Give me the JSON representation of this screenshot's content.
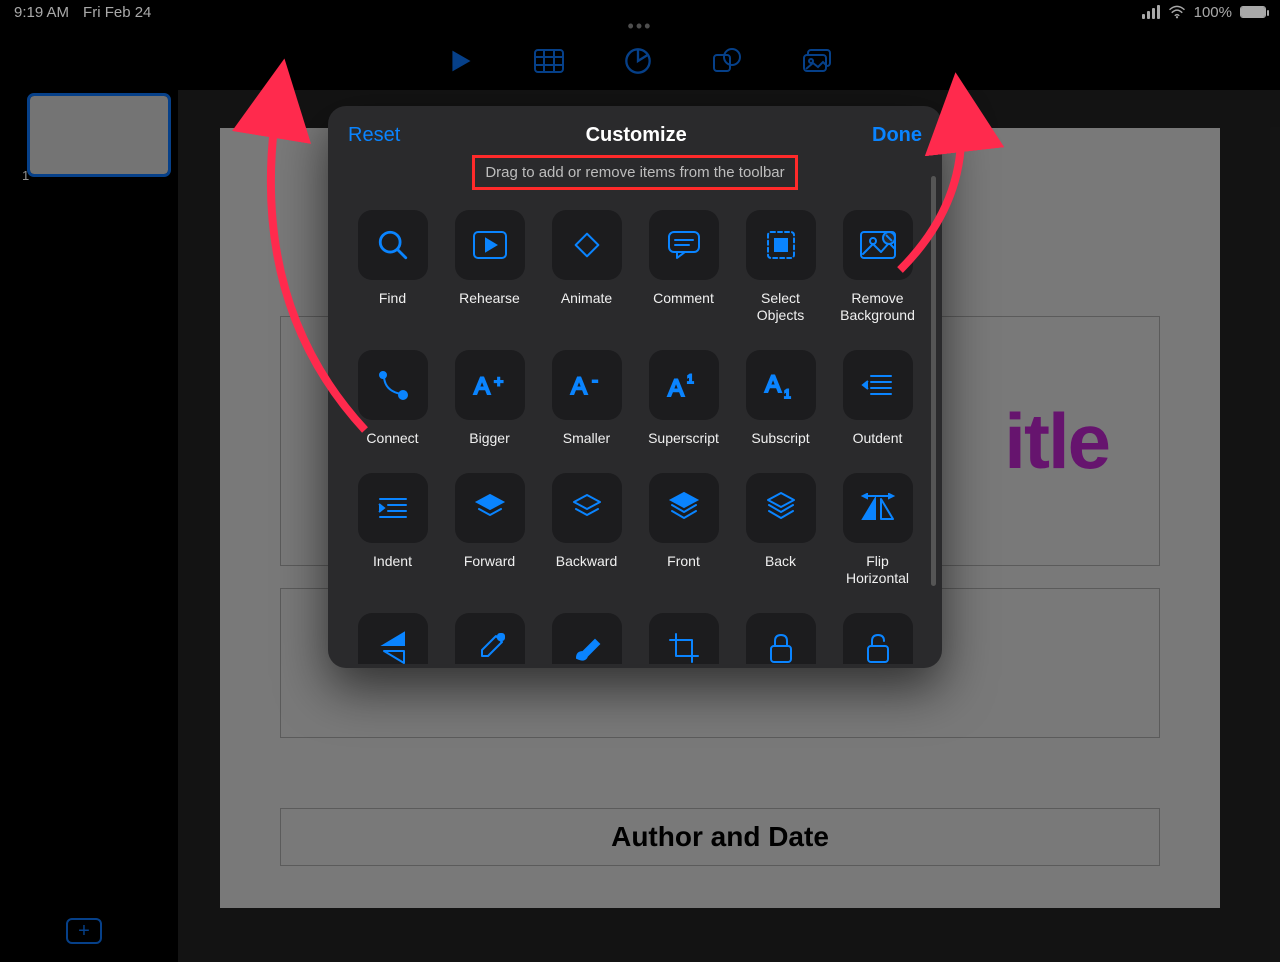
{
  "status": {
    "time": "9:19 AM",
    "date": "Fri Feb 24",
    "battery_pct": "100%"
  },
  "toolbar_icons": [
    "play-icon",
    "table-icon",
    "chart-icon",
    "shape-icon",
    "media-icon"
  ],
  "slide_panel": {
    "thumb_number": "1"
  },
  "slide_content": {
    "title_fragment": "itle",
    "author_placeholder": "Author and Date"
  },
  "popover": {
    "reset": "Reset",
    "title": "Customize",
    "done": "Done",
    "subtitle": "Drag to add or remove items from the toolbar",
    "tools": [
      {
        "key": "find",
        "label": "Find",
        "icon": "magnify"
      },
      {
        "key": "rehearse",
        "label": "Rehearse",
        "icon": "play-rect"
      },
      {
        "key": "animate",
        "label": "Animate",
        "icon": "diamond"
      },
      {
        "key": "comment",
        "label": "Comment",
        "icon": "comment"
      },
      {
        "key": "select-objects",
        "label": "Select Objects",
        "icon": "select-all"
      },
      {
        "key": "remove-background",
        "label": "Remove Background",
        "icon": "remove-bg"
      },
      {
        "key": "connect",
        "label": "Connect",
        "icon": "connect"
      },
      {
        "key": "bigger",
        "label": "Bigger",
        "icon": "a-plus"
      },
      {
        "key": "smaller",
        "label": "Smaller",
        "icon": "a-minus"
      },
      {
        "key": "superscript",
        "label": "Superscript",
        "icon": "a-sup"
      },
      {
        "key": "subscript",
        "label": "Subscript",
        "icon": "a-sub"
      },
      {
        "key": "outdent",
        "label": "Outdent",
        "icon": "outdent"
      },
      {
        "key": "indent",
        "label": "Indent",
        "icon": "indent"
      },
      {
        "key": "forward",
        "label": "Forward",
        "icon": "layer-fwd"
      },
      {
        "key": "backward",
        "label": "Backward",
        "icon": "layer-back"
      },
      {
        "key": "front",
        "label": "Front",
        "icon": "layer-front"
      },
      {
        "key": "back",
        "label": "Back",
        "icon": "layer-back2"
      },
      {
        "key": "flip-horizontal",
        "label": "Flip Horizontal",
        "icon": "flip-h"
      },
      {
        "key": "flip-vertical",
        "label": "",
        "icon": "flip-v"
      },
      {
        "key": "style-copy",
        "label": "",
        "icon": "dropper"
      },
      {
        "key": "style-paste",
        "label": "",
        "icon": "brush"
      },
      {
        "key": "crop",
        "label": "",
        "icon": "crop"
      },
      {
        "key": "lock",
        "label": "",
        "icon": "lock"
      },
      {
        "key": "unlock",
        "label": "",
        "icon": "unlock"
      }
    ]
  },
  "colors": {
    "ios_blue": "#0a84ff",
    "annotation_red": "#ff2a4d",
    "title_magenta": "#9c1fa8"
  }
}
